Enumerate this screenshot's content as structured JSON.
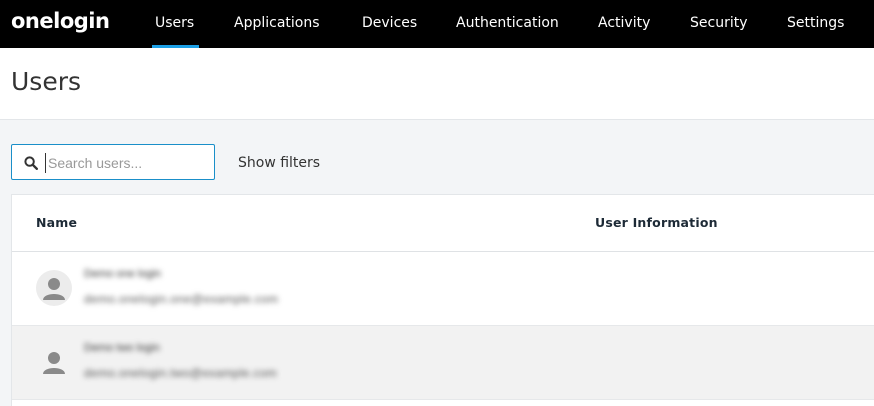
{
  "header": {
    "logo": "onelogin",
    "nav": [
      {
        "label": "Users",
        "active": true
      },
      {
        "label": "Applications",
        "active": false
      },
      {
        "label": "Devices",
        "active": false
      },
      {
        "label": "Authentication",
        "active": false
      },
      {
        "label": "Activity",
        "active": false
      },
      {
        "label": "Security",
        "active": false
      },
      {
        "label": "Settings",
        "active": false
      }
    ],
    "accent_color": "#1ca0e6"
  },
  "page": {
    "title": "Users"
  },
  "toolbar": {
    "search_placeholder": "Search users...",
    "search_value": "",
    "show_filters_label": "Show filters",
    "search_icon": "search-icon"
  },
  "table": {
    "columns": [
      "Name",
      "User Information"
    ],
    "rows": [
      {
        "name": "Demo one login",
        "email": "demo.onelogin.one@example.com",
        "user_information": ""
      },
      {
        "name": "Demo two login",
        "email": "demo.onelogin.two@example.com",
        "user_information": ""
      }
    ]
  }
}
